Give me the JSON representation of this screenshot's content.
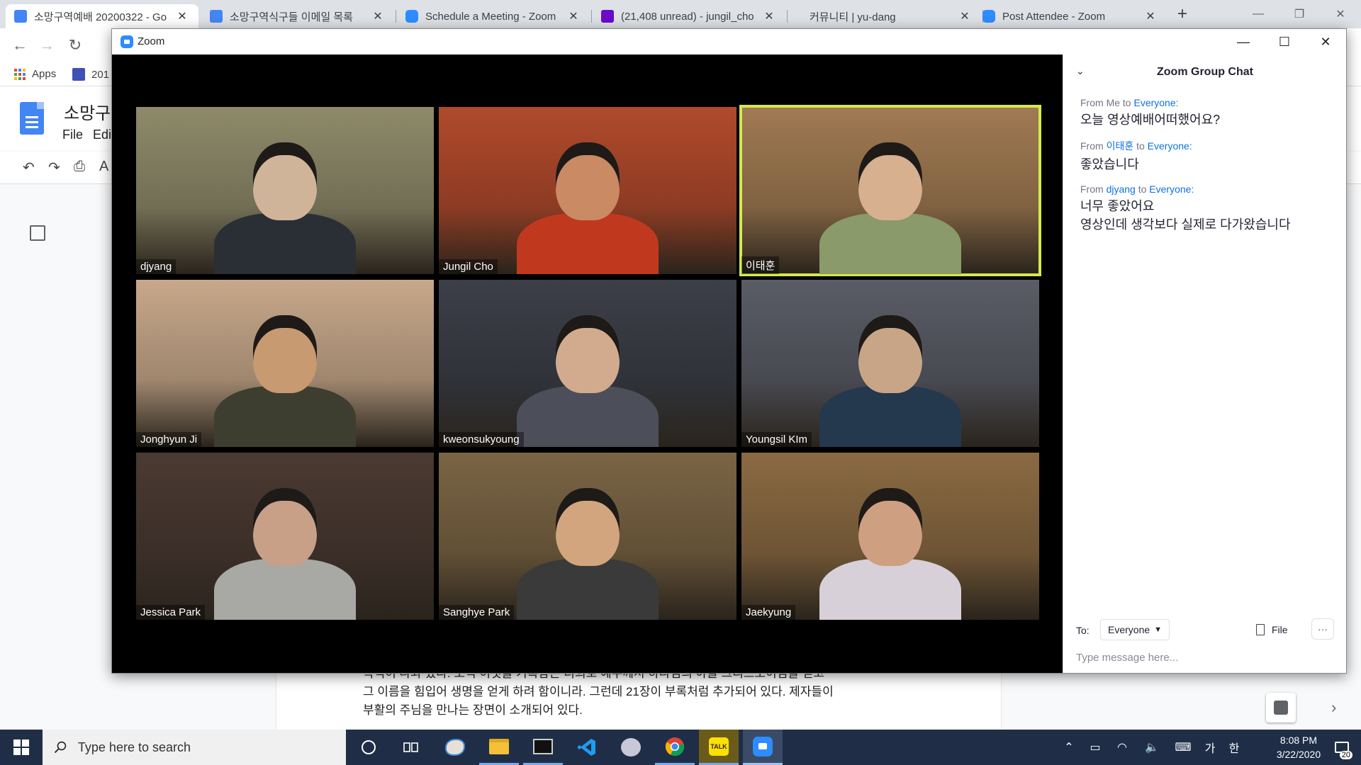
{
  "browser": {
    "tabs": [
      {
        "title": "소망구역예배 20200322 - Go",
        "icon": "google-docs-icon",
        "active": true
      },
      {
        "title": "소망구역식구들 이메일 목록",
        "icon": "google-docs-icon",
        "active": false
      },
      {
        "title": "Schedule a Meeting - Zoom",
        "icon": "zoom-icon",
        "active": false
      },
      {
        "title": "(21,408 unread) - jungil_cho",
        "icon": "mail-icon",
        "active": false
      },
      {
        "title": "커뮤니티 | yu-dang",
        "icon": "",
        "active": false
      },
      {
        "title": "Post Attendee - Zoom",
        "icon": "zoom-icon",
        "active": false
      }
    ],
    "bookmarks": {
      "apps_label": "Apps",
      "second_label": "201"
    }
  },
  "docs": {
    "title": "소망구",
    "menu": [
      "File",
      "Edi"
    ],
    "body_lines": [
      "목적이 나와 있다. 오직 이것을 기록함은 너희로 예수께서 하나님의 아들 그리스도이심을 믿고",
      "그 이름을 힘입어 생명을 얻게 하려 함이니라. 그런데 21장이 부록처럼 추가되어 있다. 제자들이",
      "부활의 주님을 만나는 장면이 소개되어 있다."
    ]
  },
  "zoom": {
    "window_title": "Zoom",
    "participants": [
      {
        "name": "djyang",
        "speaking": false,
        "bg": "#8e8a6a",
        "skin": "#d0b49a",
        "shirt": "#2a2f36"
      },
      {
        "name": "Jungil Cho",
        "speaking": false,
        "bg": "#b04a2c",
        "skin": "#c98a64",
        "shirt": "#c0391f"
      },
      {
        "name": "이태훈",
        "speaking": true,
        "bg": "#a07a52",
        "skin": "#d7b08f",
        "shirt": "#8a9a6a"
      },
      {
        "name": "Jonghyun Ji",
        "speaking": false,
        "bg": "#c7a88a",
        "skin": "#c89a72",
        "shirt": "#3e3e30"
      },
      {
        "name": "kweonsukyoung",
        "speaking": false,
        "bg": "#3c3f48",
        "skin": "#d2ab8e",
        "shirt": "#4c4e5a"
      },
      {
        "name": "Youngsil KIm",
        "speaking": false,
        "bg": "#5a5c66",
        "skin": "#c9a587",
        "shirt": "#24384e"
      },
      {
        "name": "Jessica Park",
        "speaking": false,
        "bg": "#4a3a32",
        "skin": "#c8a088",
        "shirt": "#a8a8a4"
      },
      {
        "name": "Sanghye Park",
        "speaking": false,
        "bg": "#7a6444",
        "skin": "#d2a57e",
        "shirt": "#3a3a3a"
      },
      {
        "name": "Jaekyung",
        "speaking": false,
        "bg": "#8a6a42",
        "skin": "#cf9f82",
        "shirt": "#d8d0d8"
      }
    ],
    "chat": {
      "title": "Zoom Group Chat",
      "messages": [
        {
          "from_prefix": "From",
          "from": "Me",
          "to_word": "to",
          "to": "Everyone:",
          "lines": [
            "오늘 영상예배어떠했어요?"
          ]
        },
        {
          "from_prefix": "From",
          "from": "이태훈",
          "to_word": "to",
          "to": "Everyone:",
          "lines": [
            "좋았습니다"
          ]
        },
        {
          "from_prefix": "From",
          "from": "djyang",
          "to_word": "to",
          "to": "Everyone:",
          "lines": [
            "너무 좋았어요",
            "영상인데 생각보다 실제로 다가왔습니다"
          ]
        }
      ],
      "to_label": "To:",
      "to_value": "Everyone",
      "file_label": "File",
      "more_label": "···",
      "input_placeholder": "Type message here..."
    }
  },
  "taskbar": {
    "search_placeholder": "Type here to search",
    "time": "8:08 PM",
    "date": "3/22/2020",
    "ime_lang": "가",
    "ime_mode": "한",
    "notification_count": "20"
  }
}
